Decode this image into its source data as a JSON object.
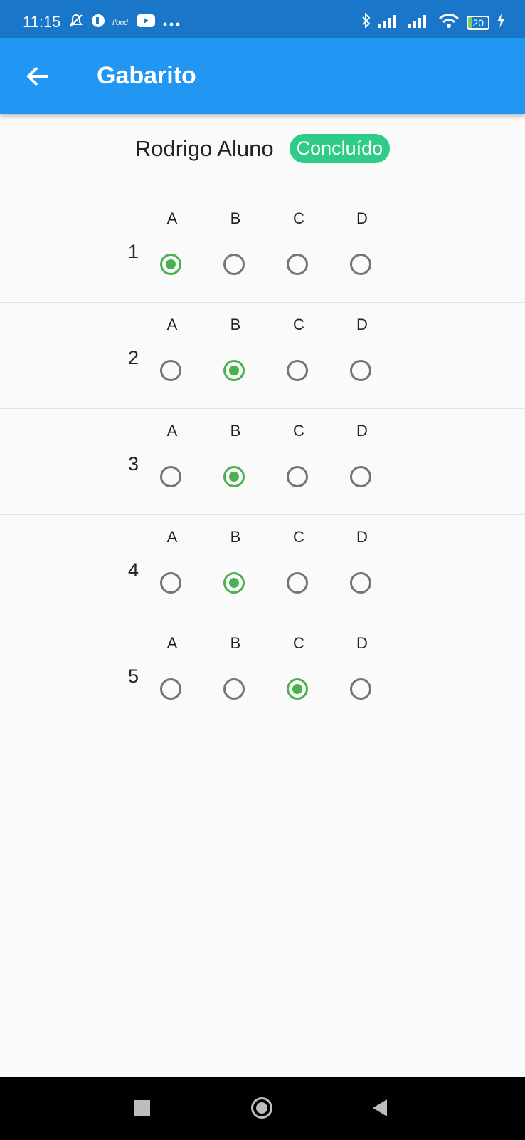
{
  "status_bar": {
    "time": "11:15",
    "left_icons": [
      "silent-icon",
      "app-icon",
      "ifood-icon",
      "youtube-icon",
      "more-dots-icon"
    ],
    "right_icons": [
      "bluetooth-icon",
      "signal-icon",
      "signal-icon",
      "wifi-icon"
    ],
    "battery": "20"
  },
  "app_bar": {
    "title": "Gabarito",
    "background_color": "#2196f3"
  },
  "student": {
    "name": "Rodrigo Aluno",
    "status": "Concluído",
    "status_color": "#2ecc86"
  },
  "questions": [
    {
      "number": "1",
      "options": [
        "A",
        "B",
        "C",
        "D"
      ],
      "selected": "A"
    },
    {
      "number": "2",
      "options": [
        "A",
        "B",
        "C",
        "D"
      ],
      "selected": "B"
    },
    {
      "number": "3",
      "options": [
        "A",
        "B",
        "C",
        "D"
      ],
      "selected": "B"
    },
    {
      "number": "4",
      "options": [
        "A",
        "B",
        "C",
        "D"
      ],
      "selected": "B"
    },
    {
      "number": "5",
      "options": [
        "A",
        "B",
        "C",
        "D"
      ],
      "selected": "C"
    }
  ],
  "selected_color": "#4caf50",
  "nav_bar": {
    "buttons": [
      "recents-square-icon",
      "home-circle-icon",
      "back-triangle-icon"
    ]
  }
}
